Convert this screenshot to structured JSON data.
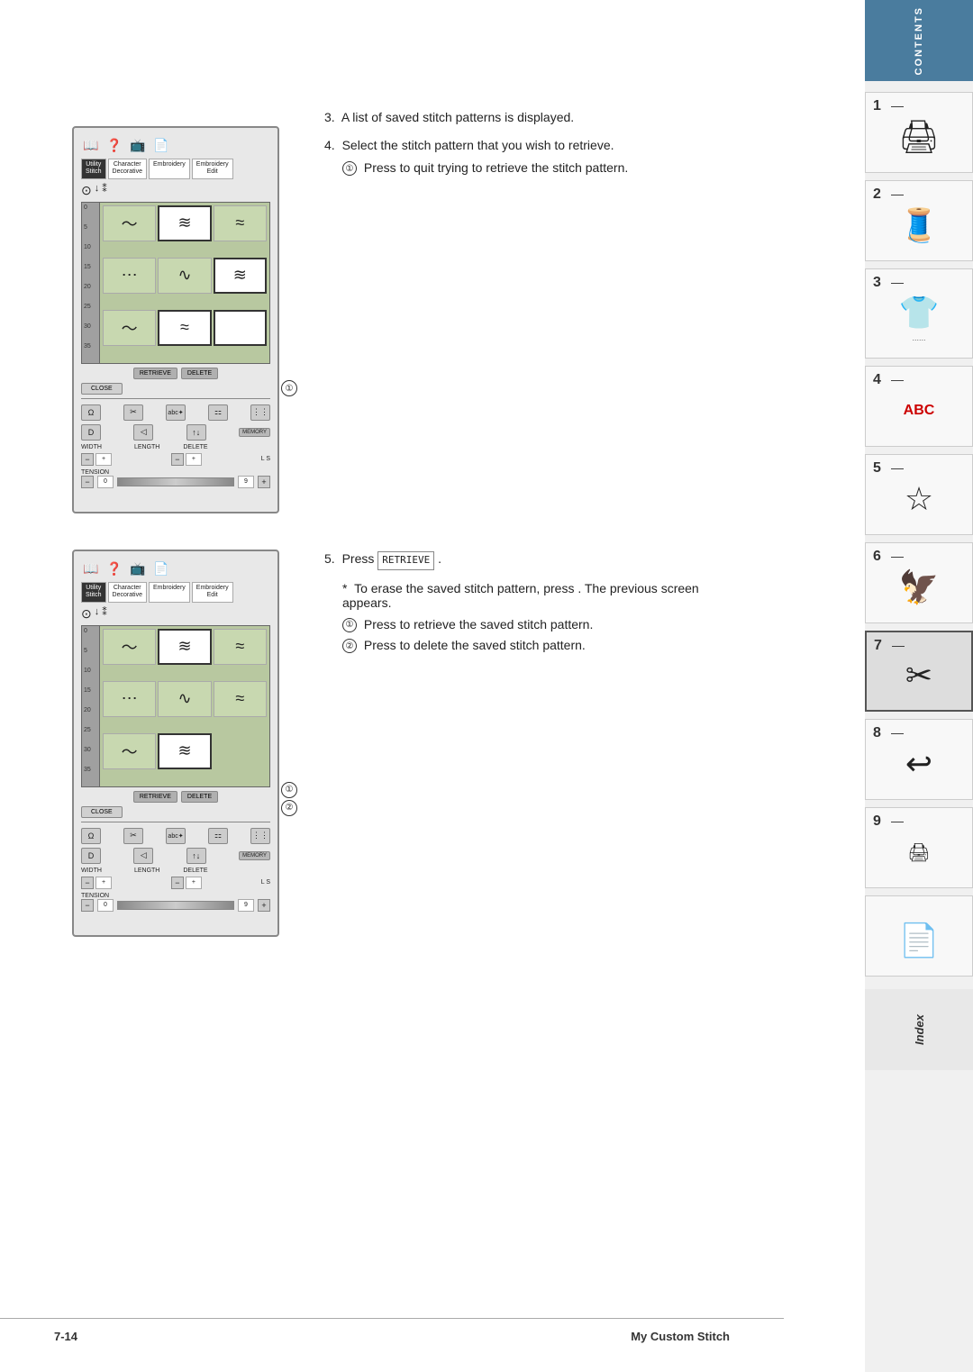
{
  "page": {
    "number": "7-14",
    "title": "My Custom Stitch"
  },
  "sidebar": {
    "contents_label": "CONTENTS",
    "index_label": "Index",
    "chapters": [
      {
        "num": "1",
        "icon": "🖨",
        "dots": ""
      },
      {
        "num": "2",
        "icon": "🧵",
        "dots": ""
      },
      {
        "num": "3",
        "icon": "👕",
        "dots": "......"
      },
      {
        "num": "4",
        "icon": "ABC",
        "dots": ""
      },
      {
        "num": "5",
        "icon": "☆",
        "dots": ""
      },
      {
        "num": "6",
        "icon": "🦅",
        "dots": ""
      },
      {
        "num": "7",
        "icon": "✂",
        "dots": ""
      },
      {
        "num": "8",
        "icon": "↩",
        "dots": ""
      },
      {
        "num": "9",
        "icon": "🖨",
        "dots": ""
      },
      {
        "num": "📄",
        "icon": "📄",
        "dots": ""
      }
    ]
  },
  "machine_panel_top": {
    "tabs": [
      {
        "label": "Utility\nStitch",
        "active": true
      },
      {
        "label": "Character\nDecorative",
        "active": false
      },
      {
        "label": "Embroidery",
        "active": false
      },
      {
        "label": "Embroidery\nEdit",
        "active": false
      }
    ]
  },
  "ruler_marks": [
    "0",
    "5",
    "10",
    "15",
    "20",
    "25",
    "30",
    "35"
  ],
  "buttons": {
    "retrieve": "RETRIEVE",
    "delete": "DELETE",
    "close": "CLOSE"
  },
  "controls": {
    "width_label": "WIDTH",
    "length_label": "LENGTH",
    "tension_label": "TENSION",
    "delete_label": "DELETE",
    "memory_label": "MEMORY",
    "ls_label": "L  S"
  },
  "steps": {
    "step3": "A list of saved stitch patterns is displayed.",
    "step4": "Select the stitch pattern that you wish to retrieve.",
    "step4_sub1": "Press to quit trying to retrieve the stitch pattern.",
    "step5": "Press",
    "step5_btn": "RETRIEVE",
    "step5_note": "To erase the saved stitch pattern, press",
    "step5_note2": ". The previous screen appears.",
    "step5_circle1": "Press to retrieve the saved stitch pattern.",
    "step5_circle2": "Press to delete the saved stitch pattern."
  }
}
